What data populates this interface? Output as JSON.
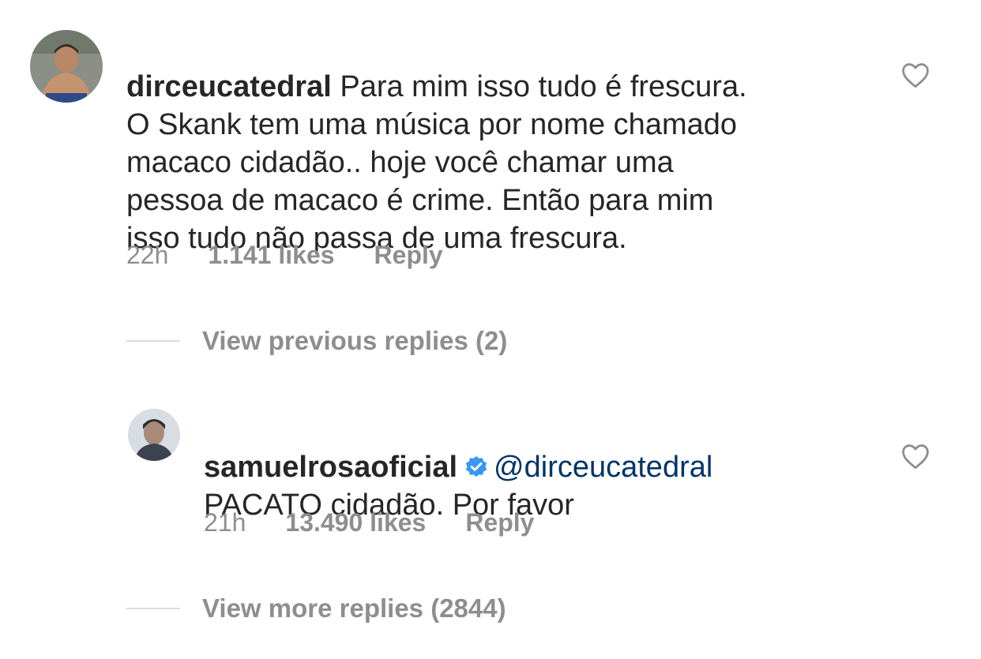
{
  "comment": {
    "username": "dirceucatedral",
    "text": " Para mim isso tudo é frescura.\nO Skank  tem uma música por nome chamado\nmacaco cidadão.. hoje você chamar uma\npessoa de macaco é crime. Então para mim\nisso tudo não passa de uma frescura.",
    "time": "22h",
    "likes": "1.141 likes",
    "reply_label": "Reply",
    "avatar_icon": "avatar-dirceucatedral",
    "like_icon": "heart-outline-icon"
  },
  "view_previous_replies": "View previous replies (2)",
  "reply": {
    "username": "samuelrosaoficial",
    "verified_icon": "verified-badge-icon",
    "mention": "@dirceucatedral",
    "text": "PACATO cidadão. Por favor",
    "time": "21h",
    "likes": "13.490 likes",
    "reply_label": "Reply",
    "avatar_icon": "avatar-samuelrosaoficial",
    "like_icon": "heart-outline-icon"
  },
  "view_more_replies": "View more replies (2844)",
  "colors": {
    "text": "#262626",
    "secondary": "#8e8e8e",
    "mention": "#003569",
    "verified": "#3897f0",
    "divider": "#dbdbdb"
  }
}
